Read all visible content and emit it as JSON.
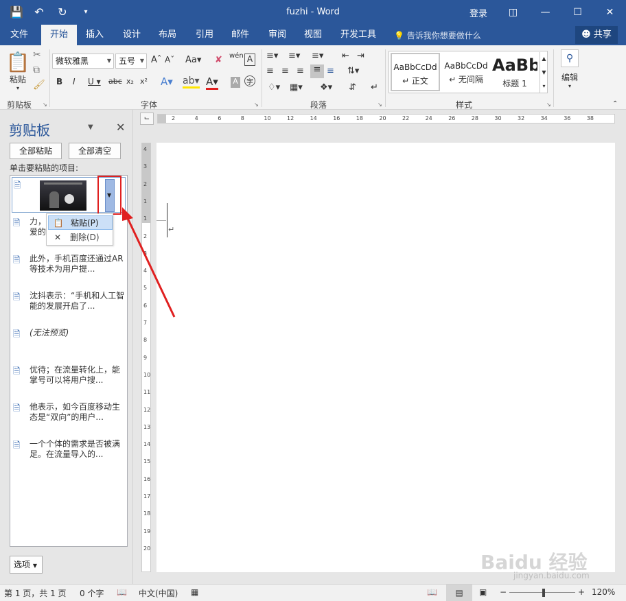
{
  "titlebar": {
    "title": "fuzhi  -  Word",
    "login": "登录",
    "qat_icons": [
      "save-icon",
      "undo-icon",
      "redo-icon",
      "customize-qat-icon"
    ]
  },
  "tabs": {
    "items": [
      "文件",
      "开始",
      "插入",
      "设计",
      "布局",
      "引用",
      "邮件",
      "审阅",
      "视图",
      "开发工具"
    ],
    "active": "开始",
    "tell_me": "告诉我你想要做什么",
    "share": "共享"
  },
  "ribbon": {
    "clipboard_group": "剪贴板",
    "paste_label": "粘贴",
    "font_group": "字体",
    "font_name": "微软雅黑",
    "font_size": "五号",
    "paragraph_group": "段落",
    "styles_group": "样式",
    "styles": [
      {
        "preview": "AaBbCcDd",
        "name": "↵ 正文"
      },
      {
        "preview": "AaBbCcDd",
        "name": "↵ 无间隔"
      },
      {
        "preview": "AaBb",
        "name": "标题 1"
      }
    ],
    "editing_label": "编辑"
  },
  "pane": {
    "title": "剪贴板",
    "paste_all": "全部粘贴",
    "clear_all": "全部清空",
    "hint": "单击要粘贴的项目:",
    "items": [
      {
        "text": "力，\n爱的"
      },
      {
        "text": "此外，手机百度还通过AR等技术为用户提..."
      },
      {
        "text": "沈抖表示：“手机和人工智能的发展开启了..."
      },
      {
        "text": "(无法预览)"
      },
      {
        "text": "优待；在流量转化上，能掌号可以将用户搜..."
      },
      {
        "text": "他表示，如今百度移动生态是“双向”的用户..."
      },
      {
        "text": "一个个体的需求是否被满足。在流量导入的..."
      }
    ],
    "context_menu": {
      "paste": "粘贴(P)",
      "delete": "删除(D)"
    },
    "options": "选项"
  },
  "ruler": {
    "h_ticks": [
      "2",
      "4",
      "6",
      "8",
      "10",
      "12",
      "14",
      "16",
      "18",
      "20",
      "22",
      "24",
      "26",
      "28",
      "30",
      "32",
      "34",
      "36",
      "38"
    ],
    "v_ticks": [
      "4",
      "3",
      "2",
      "1",
      "1",
      "2",
      "3",
      "4",
      "5",
      "6",
      "7",
      "8",
      "9",
      "10",
      "11",
      "12",
      "13",
      "14",
      "15",
      "16",
      "17",
      "18",
      "19",
      "20"
    ]
  },
  "status": {
    "page": "第 1 页，共 1 页",
    "words": "0 个字",
    "language": "中文(中国)",
    "zoom": "120%"
  },
  "watermark": {
    "brand": "Baidu 经验",
    "url": "jingyan.baidu.com"
  },
  "colors": {
    "word_blue": "#2b579a",
    "annotation_red": "#e02020"
  }
}
